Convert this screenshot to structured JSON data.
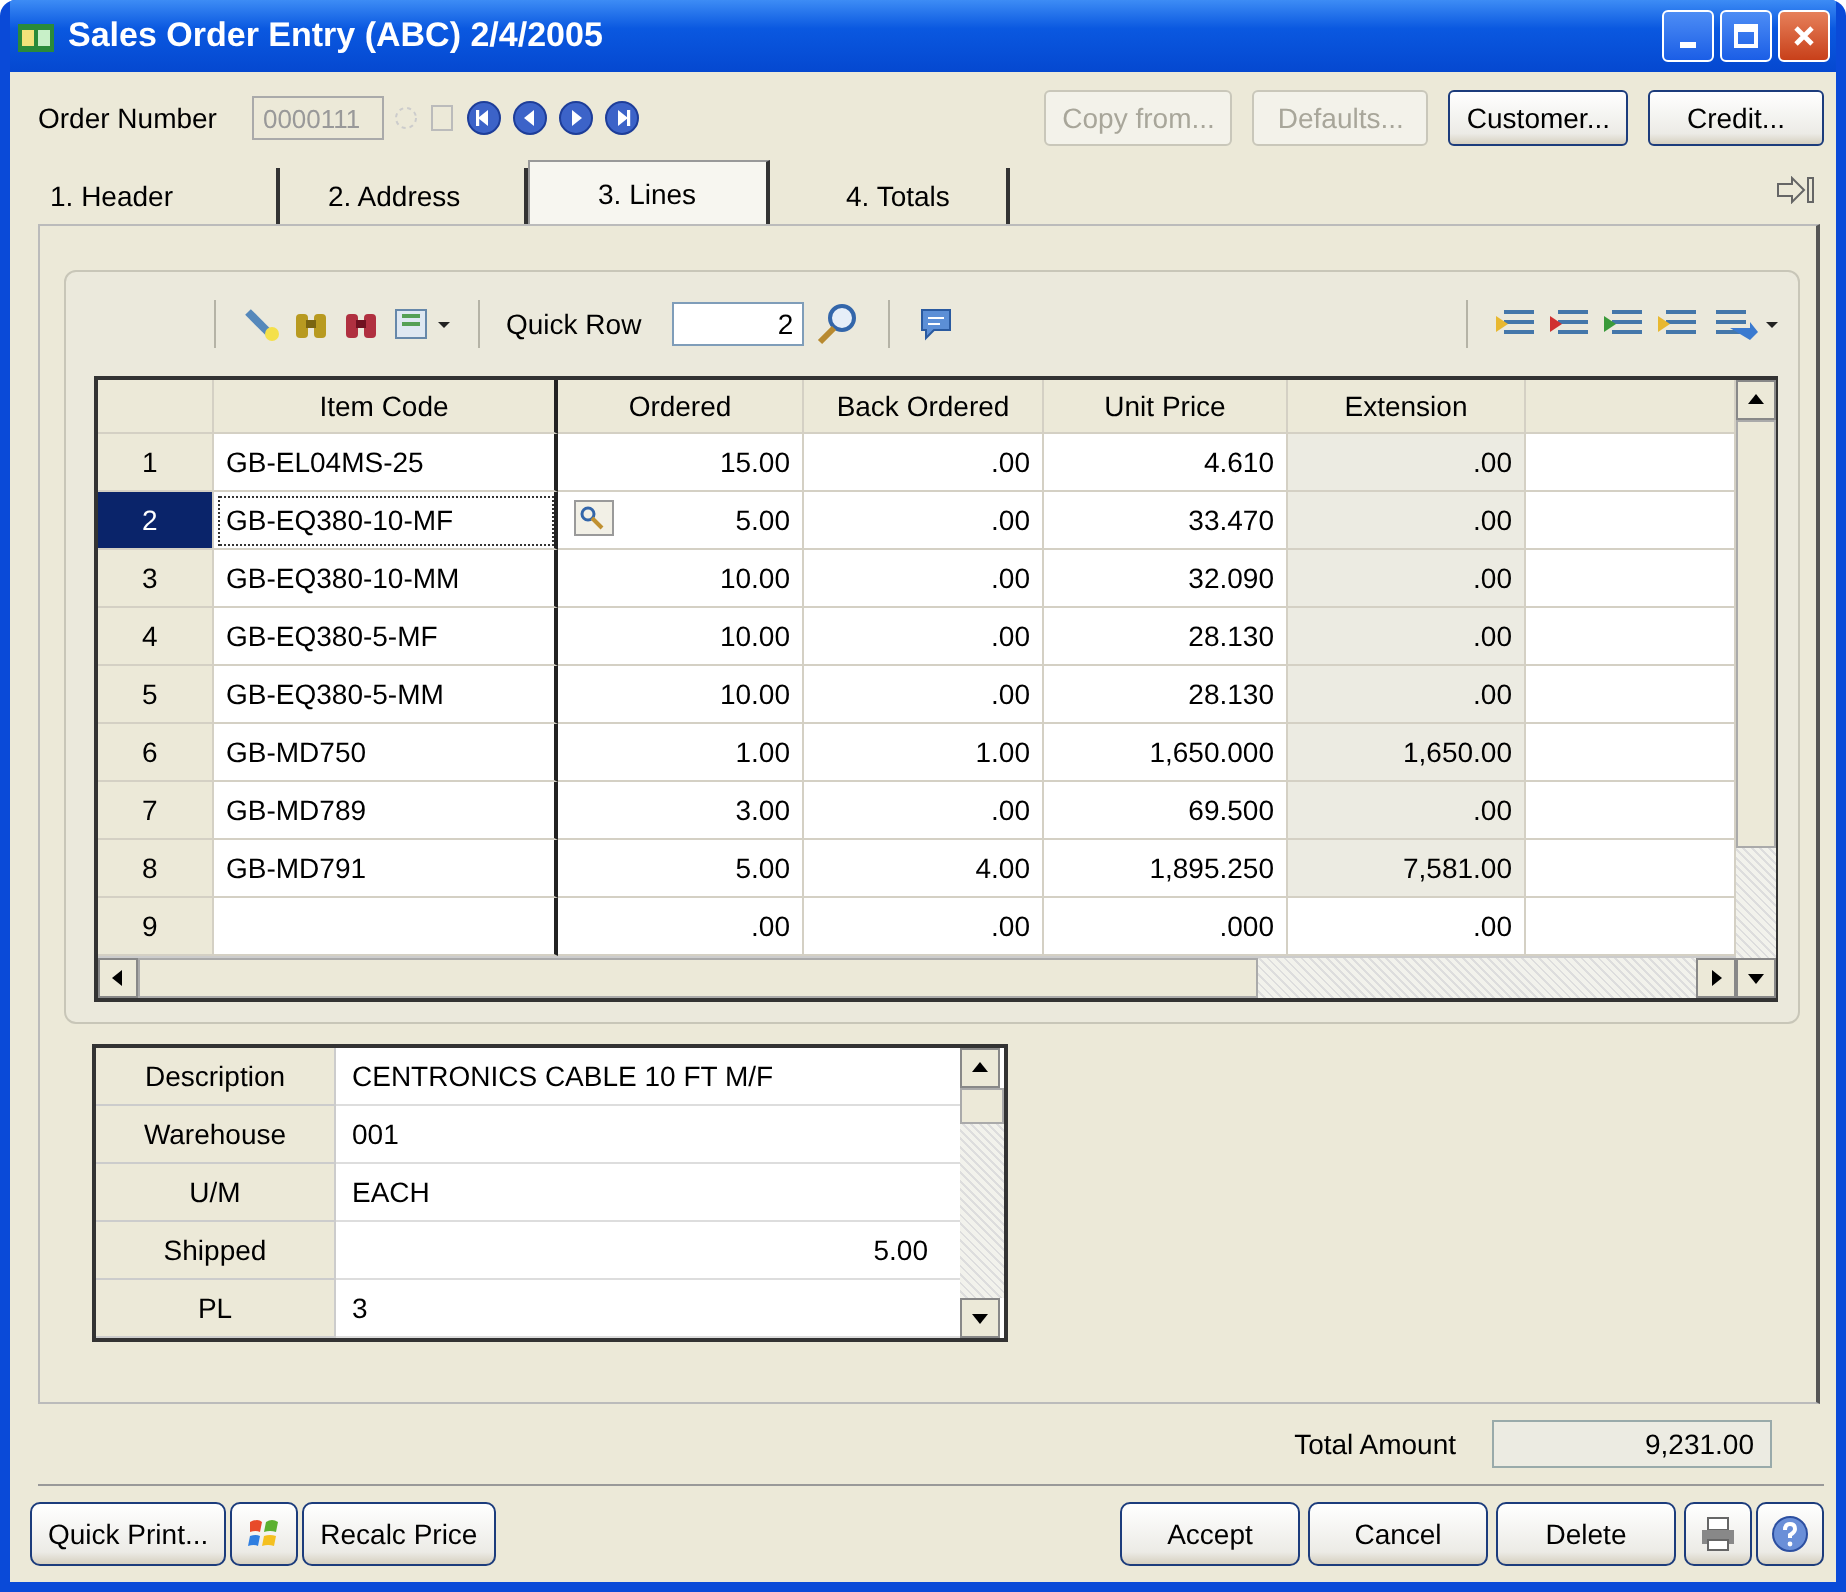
{
  "window": {
    "title": "Sales Order Entry (ABC) 2/4/2005"
  },
  "order": {
    "label": "Order Number",
    "value": "0000111",
    "disabled": true
  },
  "header_buttons": [
    {
      "label": "Copy from...",
      "disabled": true
    },
    {
      "label": "Defaults...",
      "disabled": true
    },
    {
      "label": "Customer...",
      "disabled": false
    },
    {
      "label": "Credit...",
      "disabled": false
    }
  ],
  "tabs": [
    {
      "label": "1. Header",
      "selected": false
    },
    {
      "label": "2. Address",
      "selected": false
    },
    {
      "label": "3. Lines",
      "selected": true
    },
    {
      "label": "4. Totals",
      "selected": false
    }
  ],
  "toolbar": {
    "quick_row_label": "Quick Row",
    "quick_row_value": "2"
  },
  "grid": {
    "columns": [
      "Item Code",
      "Ordered",
      "Back Ordered",
      "Unit Price",
      "Extension"
    ],
    "rows": [
      {
        "num": "1",
        "item_code": "GB-EL04MS-25",
        "ordered": "15.00",
        "back_ordered": ".00",
        "unit_price": "4.610",
        "extension": ".00",
        "kind": "line",
        "selected": false
      },
      {
        "num": "2",
        "item_code": "GB-EQ380-10-MF",
        "ordered": "5.00",
        "back_ordered": ".00",
        "unit_price": "33.470",
        "extension": ".00",
        "kind": "line",
        "selected": true
      },
      {
        "num": "3",
        "item_code": "GB-EQ380-10-MM",
        "ordered": "10.00",
        "back_ordered": ".00",
        "unit_price": "32.090",
        "extension": ".00",
        "kind": "line",
        "selected": false
      },
      {
        "num": "4",
        "item_code": "GB-EQ380-5-MF",
        "ordered": "10.00",
        "back_ordered": ".00",
        "unit_price": "28.130",
        "extension": ".00",
        "kind": "line",
        "selected": false
      },
      {
        "num": "5",
        "item_code": "GB-EQ380-5-MM",
        "ordered": "10.00",
        "back_ordered": ".00",
        "unit_price": "28.130",
        "extension": ".00",
        "kind": "line",
        "selected": false
      },
      {
        "num": "6",
        "item_code": "GB-MD750",
        "ordered": "1.00",
        "back_ordered": "1.00",
        "unit_price": "1,650.000",
        "extension": "1,650.00",
        "kind": "line",
        "selected": false
      },
      {
        "num": "7",
        "item_code": "GB-MD789",
        "ordered": "3.00",
        "back_ordered": ".00",
        "unit_price": "69.500",
        "extension": ".00",
        "kind": "line",
        "selected": false
      },
      {
        "num": "8",
        "item_code": "GB-MD791",
        "ordered": "5.00",
        "back_ordered": "4.00",
        "unit_price": "1,895.250",
        "extension": "7,581.00",
        "kind": "line",
        "selected": false
      },
      {
        "num": "9",
        "item_code": "",
        "ordered": ".00",
        "back_ordered": ".00",
        "unit_price": ".000",
        "extension": ".00",
        "kind": "new",
        "selected": false
      }
    ]
  },
  "details": [
    {
      "label": "Description",
      "value": "CENTRONICS CABLE 10 FT M/F",
      "kind": "text"
    },
    {
      "label": "Warehouse",
      "value": "001",
      "kind": "text"
    },
    {
      "label": "U/M",
      "value": "EACH",
      "kind": "text"
    },
    {
      "label": "Shipped",
      "value": "5.00",
      "kind": "number"
    },
    {
      "label": "PL",
      "value": "3",
      "kind": "text"
    }
  ],
  "total": {
    "label": "Total Amount",
    "value": "9,231.00"
  },
  "footer_left": [
    {
      "label": "Quick Print...",
      "kind": "text"
    },
    {
      "kind": "icon"
    },
    {
      "label": "Recalc Price",
      "kind": "text"
    }
  ],
  "footer_right": [
    {
      "label": "Accept",
      "kind": "text"
    },
    {
      "label": "Cancel",
      "kind": "text"
    },
    {
      "label": "Delete",
      "kind": "text"
    },
    {
      "kind": "print"
    },
    {
      "kind": "help"
    }
  ]
}
